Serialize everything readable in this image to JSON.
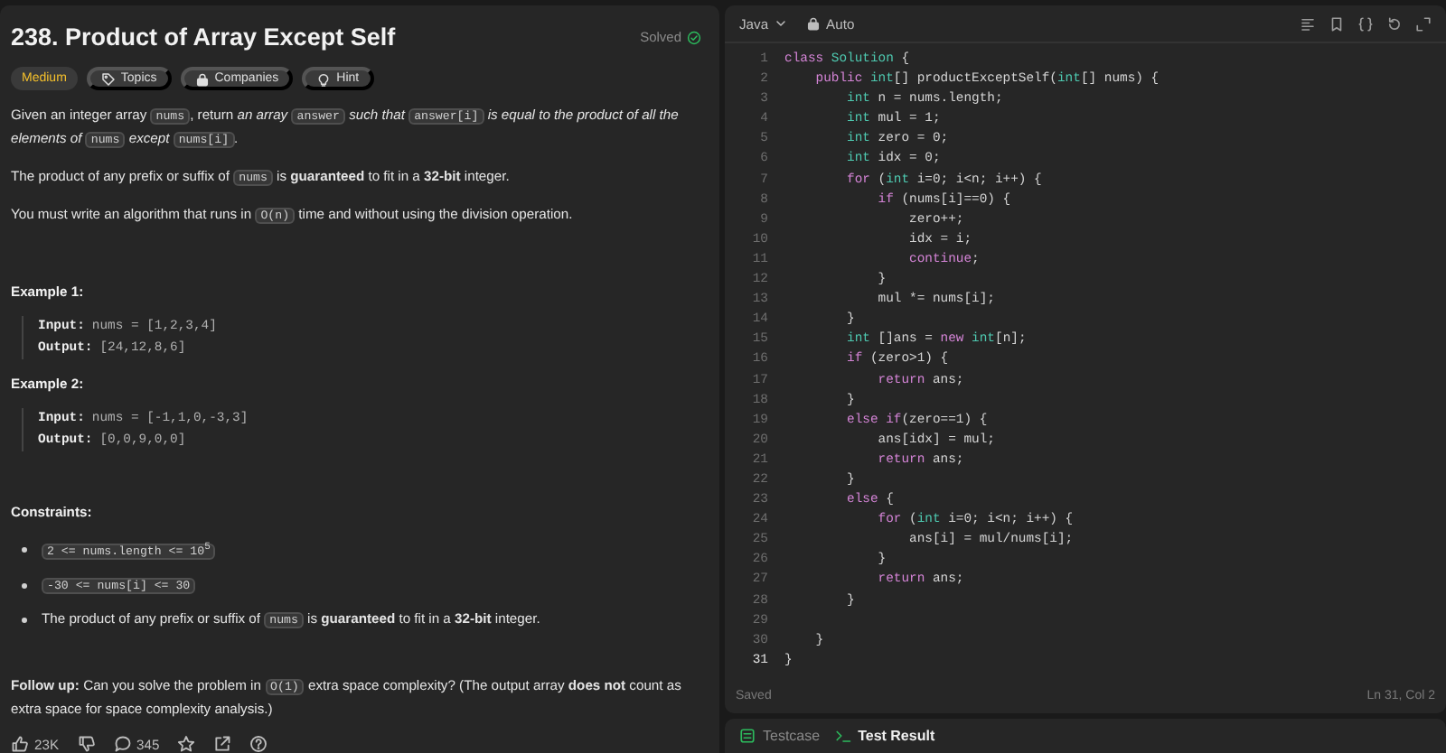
{
  "problem": {
    "title": "238. Product of Array Except Self",
    "status": "Solved",
    "tags": [
      {
        "kind": "difficulty",
        "label": "Medium"
      },
      {
        "kind": "topics",
        "label": "Topics"
      },
      {
        "kind": "companies",
        "label": "Companies"
      },
      {
        "kind": "hint",
        "label": "Hint"
      }
    ],
    "description": [
      [
        {
          "kind": "text",
          "text": "Given an integer array "
        },
        {
          "kind": "code",
          "text": "nums"
        },
        {
          "kind": "text",
          "text": ", return *an array* "
        },
        {
          "kind": "code",
          "text": "answer"
        },
        {
          "kind": "text",
          "text": " *such that* "
        },
        {
          "kind": "code",
          "text": "answer[i]"
        },
        {
          "kind": "text",
          "text": " *is equal to the product of all the elements of* "
        },
        {
          "kind": "code",
          "text": "nums"
        },
        {
          "kind": "text",
          "text": " *except* "
        },
        {
          "kind": "code",
          "text": "nums[i]"
        },
        {
          "kind": "text",
          "text": "."
        }
      ],
      [
        {
          "kind": "text",
          "text": "The product of any prefix or suffix of "
        },
        {
          "kind": "code",
          "text": "nums"
        },
        {
          "kind": "text",
          "text": " is **guaranteed** to fit in a **32-bit** integer."
        }
      ],
      [
        {
          "kind": "text",
          "text": "You must write an algorithm that runs in "
        },
        {
          "kind": "code",
          "text": "O(n)"
        },
        {
          "kind": "text",
          "text": " time and without using the division operation."
        }
      ]
    ],
    "examples": [
      {
        "heading": "Example 1:",
        "input_label": "Input:",
        "input": "nums = [1,2,3,4]",
        "output_label": "Output:",
        "output": "[24,12,8,6]"
      },
      {
        "heading": "Example 2:",
        "input_label": "Input:",
        "input": "nums = [-1,1,0,-3,3]",
        "output_label": "Output:",
        "output": "[0,0,9,0,0]"
      }
    ],
    "constraints_heading": "Constraints:",
    "constraints": [
      [
        {
          "kind": "code",
          "text": "2 <= nums.length <= 10$^{5}$"
        }
      ],
      [
        {
          "kind": "code",
          "text": "-30 <= nums[i] <= 30"
        }
      ],
      [
        {
          "kind": "text",
          "text": "The product of any prefix or suffix of "
        },
        {
          "kind": "code",
          "text": "nums"
        },
        {
          "kind": "text",
          "text": " is **guaranteed** to fit in a **32-bit** integer."
        }
      ]
    ],
    "follow_up": [
      {
        "kind": "text",
        "text": "**Follow up:** Can you solve the problem in "
      },
      {
        "kind": "code",
        "text": "O(1)"
      },
      {
        "kind": "text",
        "text": " extra space complexity? (The output array **does not** count as extra space for space complexity analysis.)"
      }
    ],
    "actions": [
      {
        "kind": "like",
        "count": "23K"
      },
      {
        "kind": "dislike"
      },
      {
        "kind": "comments",
        "count": "345"
      },
      {
        "kind": "star"
      },
      {
        "kind": "share"
      },
      {
        "kind": "help"
      }
    ]
  },
  "editor": {
    "language": "Java",
    "mode": "Auto",
    "lines": [
      {
        "number": "1",
        "current": false,
        "tokens": [
          {
            "kind": "keyword",
            "text": "class"
          },
          {
            "kind": "type",
            "text": " Solution"
          },
          {
            "kind": "plain",
            "text": " {"
          }
        ]
      },
      {
        "number": "2",
        "current": false,
        "tokens": [
          {
            "kind": "keyword",
            "text": "    public"
          },
          {
            "kind": "type",
            "text": " int"
          },
          {
            "kind": "plain",
            "text": "[] productExceptSelf("
          },
          {
            "kind": "type",
            "text": "int"
          },
          {
            "kind": "plain",
            "text": "[] nums) {"
          }
        ]
      },
      {
        "number": "3",
        "current": false,
        "tokens": [
          {
            "kind": "type",
            "text": "        int"
          },
          {
            "kind": "plain",
            "text": " n = nums.length;"
          }
        ]
      },
      {
        "number": "4",
        "current": false,
        "tokens": [
          {
            "kind": "type",
            "text": "        int"
          },
          {
            "kind": "plain",
            "text": " mul = 1;"
          }
        ]
      },
      {
        "number": "5",
        "current": false,
        "tokens": [
          {
            "kind": "type",
            "text": "        int"
          },
          {
            "kind": "plain",
            "text": " zero = 0;"
          }
        ]
      },
      {
        "number": "6",
        "current": false,
        "tokens": [
          {
            "kind": "type",
            "text": "        int"
          },
          {
            "kind": "plain",
            "text": " idx = 0;"
          }
        ]
      },
      {
        "number": "7",
        "current": false,
        "tokens": [
          {
            "kind": "keyword",
            "text": "        for"
          },
          {
            "kind": "plain",
            "text": " ("
          },
          {
            "kind": "type",
            "text": "int"
          },
          {
            "kind": "plain",
            "text": " i=0; i<n; i++) {"
          }
        ]
      },
      {
        "number": "8",
        "current": false,
        "tokens": [
          {
            "kind": "keyword",
            "text": "            if"
          },
          {
            "kind": "plain",
            "text": " (nums[i]==0) {"
          }
        ]
      },
      {
        "number": "9",
        "current": false,
        "tokens": [
          {
            "kind": "plain",
            "text": "                zero++;"
          }
        ]
      },
      {
        "number": "10",
        "current": false,
        "tokens": [
          {
            "kind": "plain",
            "text": "                idx = i;"
          }
        ]
      },
      {
        "number": "11",
        "current": false,
        "tokens": [
          {
            "kind": "keyword",
            "text": "                continue"
          },
          {
            "kind": "plain",
            "text": ";"
          }
        ]
      },
      {
        "number": "12",
        "current": false,
        "tokens": [
          {
            "kind": "plain",
            "text": "            }"
          }
        ]
      },
      {
        "number": "13",
        "current": false,
        "tokens": [
          {
            "kind": "plain",
            "text": "            mul *= nums[i];"
          }
        ]
      },
      {
        "number": "14",
        "current": false,
        "tokens": [
          {
            "kind": "plain",
            "text": "        }"
          }
        ]
      },
      {
        "number": "15",
        "current": false,
        "tokens": [
          {
            "kind": "type",
            "text": "        int"
          },
          {
            "kind": "plain",
            "text": " []ans = "
          },
          {
            "kind": "keyword",
            "text": "new"
          },
          {
            "kind": "type",
            "text": " int"
          },
          {
            "kind": "plain",
            "text": "[n];"
          }
        ]
      },
      {
        "number": "16",
        "current": false,
        "tokens": [
          {
            "kind": "keyword",
            "text": "        if"
          },
          {
            "kind": "plain",
            "text": " (zero>1) {"
          }
        ]
      },
      {
        "number": "17",
        "current": false,
        "tokens": [
          {
            "kind": "keyword",
            "text": "            return"
          },
          {
            "kind": "plain",
            "text": " ans;"
          }
        ]
      },
      {
        "number": "18",
        "current": false,
        "tokens": [
          {
            "kind": "plain",
            "text": "        }"
          }
        ]
      },
      {
        "number": "19",
        "current": false,
        "tokens": [
          {
            "kind": "keyword",
            "text": "        else"
          },
          {
            "kind": "keyword",
            "text": " if"
          },
          {
            "kind": "plain",
            "text": "(zero==1) {"
          }
        ]
      },
      {
        "number": "20",
        "current": false,
        "tokens": [
          {
            "kind": "plain",
            "text": "            ans[idx] = mul;"
          }
        ]
      },
      {
        "number": "21",
        "current": false,
        "tokens": [
          {
            "kind": "keyword",
            "text": "            return"
          },
          {
            "kind": "plain",
            "text": " ans;"
          }
        ]
      },
      {
        "number": "22",
        "current": false,
        "tokens": [
          {
            "kind": "plain",
            "text": "        }"
          }
        ]
      },
      {
        "number": "23",
        "current": false,
        "tokens": [
          {
            "kind": "keyword",
            "text": "        else"
          },
          {
            "kind": "plain",
            "text": " {"
          }
        ]
      },
      {
        "number": "24",
        "current": false,
        "tokens": [
          {
            "kind": "keyword",
            "text": "            for"
          },
          {
            "kind": "plain",
            "text": " ("
          },
          {
            "kind": "type",
            "text": "int"
          },
          {
            "kind": "plain",
            "text": " i=0; i<n; i++) {"
          }
        ]
      },
      {
        "number": "25",
        "current": false,
        "tokens": [
          {
            "kind": "plain",
            "text": "                ans[i] = mul/nums[i];"
          }
        ]
      },
      {
        "number": "26",
        "current": false,
        "tokens": [
          {
            "kind": "plain",
            "text": "            }"
          }
        ]
      },
      {
        "number": "27",
        "current": false,
        "tokens": [
          {
            "kind": "keyword",
            "text": "            return"
          },
          {
            "kind": "plain",
            "text": " ans;"
          }
        ]
      },
      {
        "number": "28",
        "current": false,
        "tokens": [
          {
            "kind": "plain",
            "text": "        }"
          }
        ]
      },
      {
        "number": "29",
        "current": false
      },
      {
        "number": "30",
        "current": false,
        "tokens": [
          {
            "kind": "plain",
            "text": "    }"
          }
        ]
      },
      {
        "number": "31",
        "current": true,
        "tokens": [
          {
            "kind": "plain",
            "text": "}"
          }
        ]
      }
    ],
    "save_status": "Saved",
    "cursor": "Ln 31, Col 2"
  },
  "bottom_tabs": [
    {
      "kind": "testcase",
      "label": "Testcase",
      "selected": false
    },
    {
      "kind": "result",
      "label": "Test Result",
      "selected": true
    }
  ]
}
